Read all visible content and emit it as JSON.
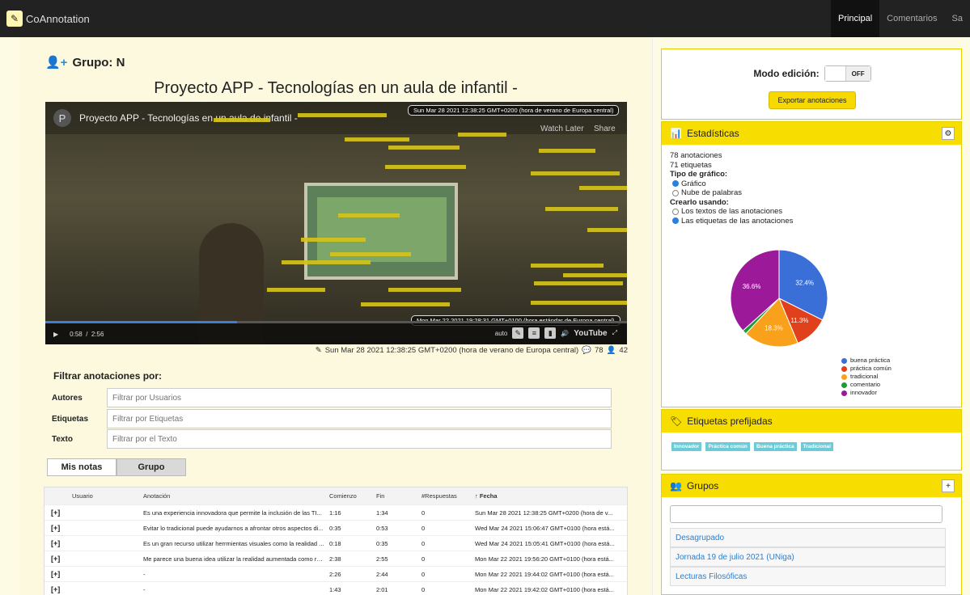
{
  "app": {
    "brand": "CoAnnotation"
  },
  "nav": {
    "tabs": [
      "Principal",
      "Comentarios",
      "Sa"
    ]
  },
  "page": {
    "group_title": "Grupo: N",
    "video_title": "Proyecto APP - Tecnologías en un aula de infantil -"
  },
  "video": {
    "channel_initial": "P",
    "header_title": "Proyecto APP - Tecnologías en un aula de infantil -",
    "watch_later": "Watch Later",
    "share": "Share",
    "ts_top": "Sun Mar 28 2021 12:38:25 GMT+0200 (hora de verano de Europa central)",
    "ts_bottom": "Mon Mar 22 2021 19:28:31 GMT+0100 (hora estándar de Europa central)",
    "time_current": "0:58",
    "time_sep": "/",
    "time_total": "2:56",
    "quality": "auto",
    "youtube": "YouTube",
    "progress": 0.33
  },
  "meta": {
    "date": "Sun Mar 28 2021 12:38:25 GMT+0200 (hora de verano de Europa central)",
    "comments": "78",
    "users": "42"
  },
  "filters": {
    "title": "Filtrar anotaciones por:",
    "rows": [
      {
        "label": "Autores",
        "placeholder": "Filtrar por Usuarios"
      },
      {
        "label": "Etiquetas",
        "placeholder": "Filtrar por Etiquetas"
      },
      {
        "label": "Texto",
        "placeholder": "Filtrar por el Texto"
      }
    ]
  },
  "tabs": {
    "mine": "Mis notas",
    "group": "Grupo"
  },
  "table": {
    "headers": [
      "Usuario",
      "Anotación",
      "Comienzo",
      "Fin",
      "#Respuestas",
      "↑ Fecha"
    ],
    "rows": [
      {
        "expand": "[+]",
        "user": "",
        "text": "Es una experiencia innovadora que permite la inclusión de las TI...",
        "start": "1:16",
        "end": "1:34",
        "replies": "0",
        "date": "Sun Mar 28 2021 12:38:25 GMT+0200 (hora de v..."
      },
      {
        "expand": "[+]",
        "user": "",
        "text": "Evitar lo tradicional puede ayudarnos a afrontar otros aspectos di...",
        "start": "0:35",
        "end": "0:53",
        "replies": "0",
        "date": "Wed Mar 24 2021 15:06:47 GMT+0100 (hora está..."
      },
      {
        "expand": "[+]",
        "user": "",
        "text": "Es un gran recurso utilizar herrmientas visuales como la realidad ...",
        "start": "0:18",
        "end": "0:35",
        "replies": "0",
        "date": "Wed Mar 24 2021 15:05:41 GMT+0100 (hora está..."
      },
      {
        "expand": "[+]",
        "user": "",
        "text": "Me parece una buena idea utilizar la realidad aumentada como re...",
        "start": "2:38",
        "end": "2:55",
        "replies": "0",
        "date": "Mon Mar 22 2021 19:56:20 GMT+0100 (hora está..."
      },
      {
        "expand": "[+]",
        "user": "",
        "text": "-",
        "start": "2:26",
        "end": "2:44",
        "replies": "0",
        "date": "Mon Mar 22 2021 19:44:02 GMT+0100 (hora está..."
      },
      {
        "expand": "[+]",
        "user": "",
        "text": "-",
        "start": "1:43",
        "end": "2:01",
        "replies": "0",
        "date": "Mon Mar 22 2021 19:42:02 GMT+0100 (hora está..."
      }
    ]
  },
  "edit": {
    "label": "Modo edición:",
    "toggle": "OFF",
    "export": "Exportar anotaciones"
  },
  "stats": {
    "title": "Estadísticas",
    "count_ann": "78 anotaciones",
    "count_tags": "71 etiquetas",
    "chart_type_label": "Tipo de gráfico:",
    "opt_chart": "Gráfico",
    "opt_words": "Nube de palabras",
    "build_label": "Crearlo usando:",
    "opt_texts": "Los textos de las anotaciones",
    "opt_tags": "Las etiquetas de las anotaciones"
  },
  "chart_data": {
    "type": "pie",
    "categories": [
      "buena práctica",
      "práctica común",
      "tradicional",
      "comentario",
      "innovador"
    ],
    "values": [
      32.4,
      11.3,
      18.3,
      1.4,
      36.6
    ],
    "colors": [
      "#3a6fd8",
      "#e0401c",
      "#f9a11b",
      "#1f9a3a",
      "#9c1a99"
    ],
    "labels": [
      "32.4%",
      "11.3%",
      "18.3%",
      "",
      "36.6%"
    ],
    "legend_position": "right"
  },
  "tags_panel": {
    "title": "Etiquetas prefijadas",
    "tags": [
      "Innovador",
      "Práctica común",
      "Buena práctica",
      "Tradicional"
    ]
  },
  "groups": {
    "title": "Grupos",
    "items": [
      "Desagrupado",
      "Jornada 19 de julio 2021 (UNiga)",
      "Lecturas Filosóficas"
    ]
  }
}
